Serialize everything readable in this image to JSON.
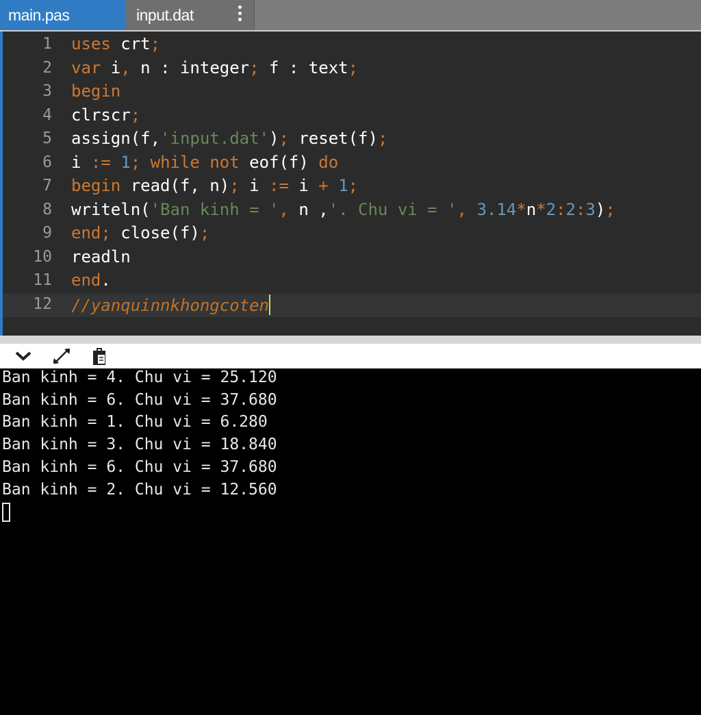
{
  "tabs": [
    {
      "label": "main.pas",
      "active": true
    },
    {
      "label": "input.dat",
      "active": false
    }
  ],
  "icons": {
    "tab_menu": "vertical-dots-icon",
    "collapse": "chevron-down-icon",
    "expand": "expand-arrows-icon",
    "clipboard": "clipboard-icon"
  },
  "colors": {
    "active_tab": "#2f7cc4",
    "editor_bg": "#2b2b2b",
    "keyword": "#cc7832",
    "string": "#6a8759",
    "number": "#6897bb",
    "console_bg": "#000000"
  },
  "editor": {
    "lines": [
      {
        "num": "1",
        "tokens": [
          [
            "k",
            "uses"
          ],
          [
            "t",
            " crt"
          ],
          [
            "k",
            ";"
          ]
        ]
      },
      {
        "num": "2",
        "tokens": [
          [
            "k",
            "var"
          ],
          [
            "t",
            " i"
          ],
          [
            "k",
            ","
          ],
          [
            "t",
            " n : integer"
          ],
          [
            "k",
            ";"
          ],
          [
            "t",
            " f : text"
          ],
          [
            "k",
            ";"
          ]
        ]
      },
      {
        "num": "3",
        "tokens": [
          [
            "k",
            "begin"
          ]
        ]
      },
      {
        "num": "4",
        "tokens": [
          [
            "t",
            "clrscr"
          ],
          [
            "k",
            ";"
          ]
        ]
      },
      {
        "num": "5",
        "tokens": [
          [
            "t",
            "assign(f,"
          ],
          [
            "s",
            "'input.dat'"
          ],
          [
            "t",
            ")"
          ],
          [
            "k",
            ";"
          ],
          [
            "t",
            " reset(f)"
          ],
          [
            "k",
            ";"
          ]
        ]
      },
      {
        "num": "6",
        "tokens": [
          [
            "t",
            "i "
          ],
          [
            "k",
            ":="
          ],
          [
            "t",
            " "
          ],
          [
            "n",
            "1"
          ],
          [
            "k",
            ";"
          ],
          [
            "t",
            " "
          ],
          [
            "k",
            "while not"
          ],
          [
            "t",
            " eof(f) "
          ],
          [
            "k",
            "do"
          ]
        ]
      },
      {
        "num": "7",
        "tokens": [
          [
            "k",
            "begin"
          ],
          [
            "t",
            " read(f, n)"
          ],
          [
            "k",
            ";"
          ],
          [
            "t",
            " i "
          ],
          [
            "k",
            ":="
          ],
          [
            "t",
            " i "
          ],
          [
            "k",
            "+"
          ],
          [
            "t",
            " "
          ],
          [
            "n",
            "1"
          ],
          [
            "k",
            ";"
          ]
        ]
      },
      {
        "num": "8",
        "tokens": [
          [
            "t",
            "writeln("
          ],
          [
            "s",
            "'Ban kinh = '"
          ],
          [
            "k",
            ","
          ],
          [
            "t",
            " n ,"
          ],
          [
            "s",
            "'. Chu vi = '"
          ],
          [
            "k",
            ","
          ],
          [
            "t",
            " "
          ],
          [
            "n",
            "3.14"
          ],
          [
            "k",
            "*"
          ],
          [
            "t",
            "n"
          ],
          [
            "k",
            "*"
          ],
          [
            "n",
            "2"
          ],
          [
            "k",
            ":"
          ],
          [
            "n",
            "2"
          ],
          [
            "k",
            ":"
          ],
          [
            "n",
            "3"
          ],
          [
            "t",
            ")"
          ],
          [
            "k",
            ";"
          ]
        ]
      },
      {
        "num": "9",
        "tokens": [
          [
            "k",
            "end;"
          ],
          [
            "t",
            " close(f)"
          ],
          [
            "k",
            ";"
          ]
        ]
      },
      {
        "num": "10",
        "tokens": [
          [
            "t",
            "readln"
          ]
        ]
      },
      {
        "num": "11",
        "tokens": [
          [
            "k",
            "end"
          ],
          [
            "t",
            "."
          ]
        ]
      },
      {
        "num": "12",
        "tokens": [
          [
            "c",
            "//yanquinnkhongcoten"
          ]
        ],
        "active": true
      }
    ]
  },
  "console": {
    "lines": [
      "Ban kinh = 4. Chu vi = 25.120",
      "Ban kinh = 6. Chu vi = 37.680",
      "Ban kinh = 1. Chu vi = 6.280",
      "Ban kinh = 3. Chu vi = 18.840",
      "Ban kinh = 6. Chu vi = 37.680",
      "Ban kinh = 2. Chu vi = 12.560"
    ]
  }
}
